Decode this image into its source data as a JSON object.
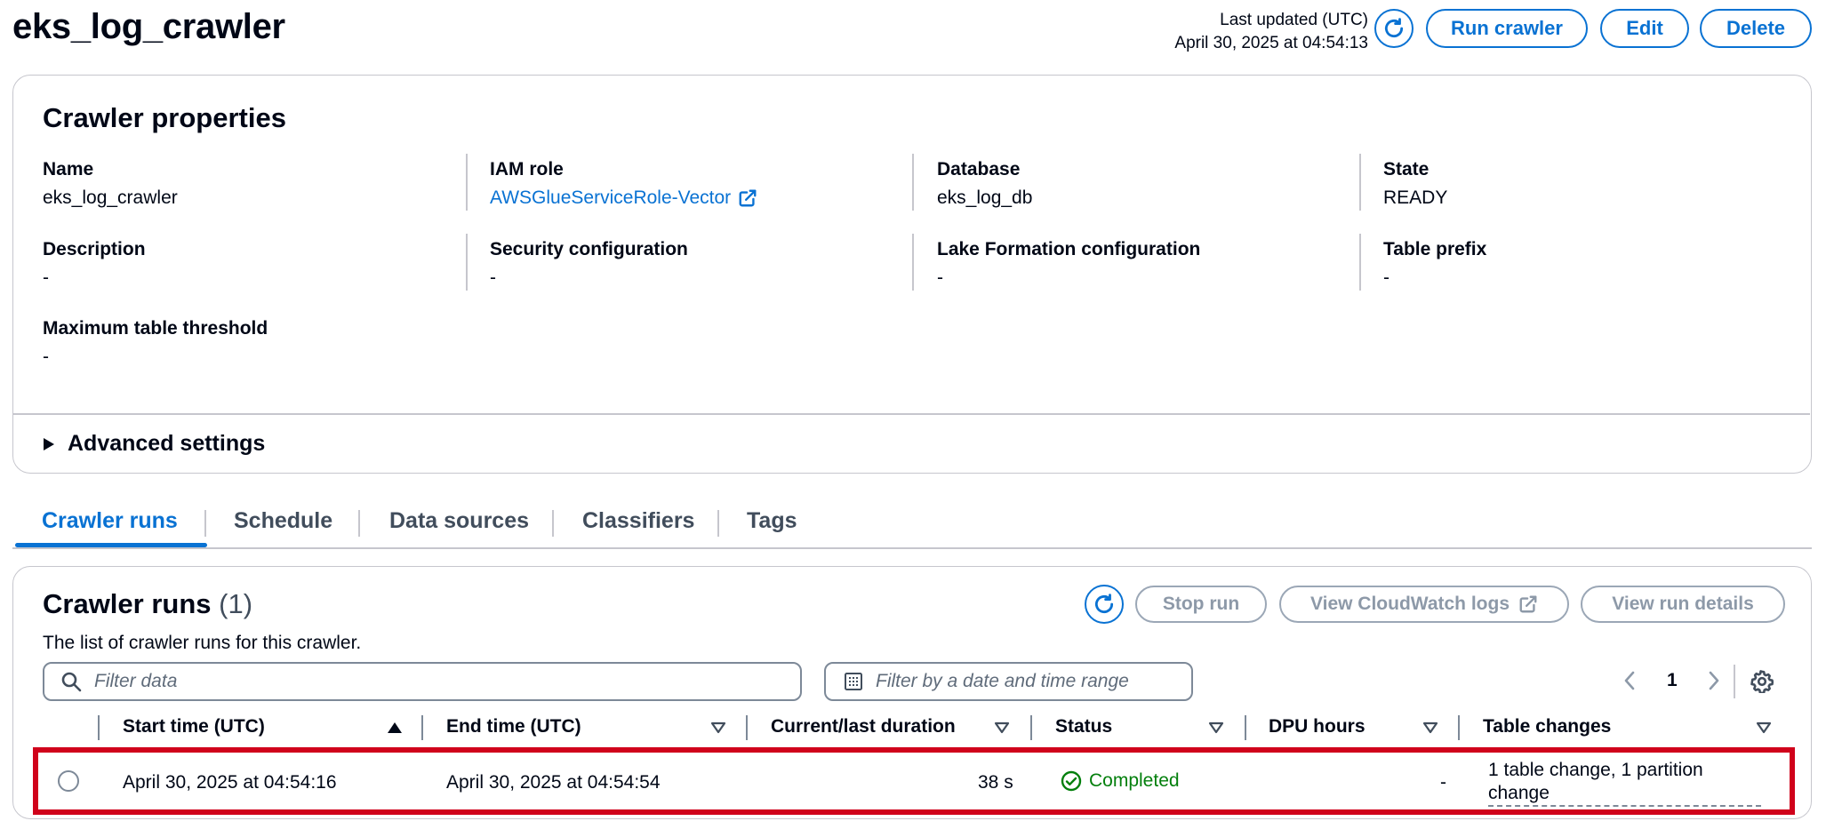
{
  "header": {
    "title": "eks_log_crawler",
    "last_updated_label": "Last updated (UTC)",
    "last_updated_value": "April 30, 2025 at 04:54:13",
    "run_crawler": "Run crawler",
    "edit": "Edit",
    "delete": "Delete"
  },
  "properties": {
    "title": "Crawler properties",
    "name_label": "Name",
    "name_value": "eks_log_crawler",
    "iam_label": "IAM role",
    "iam_value": "AWSGlueServiceRole-Vector",
    "database_label": "Database",
    "database_value": "eks_log_db",
    "state_label": "State",
    "state_value": "READY",
    "description_label": "Description",
    "description_value": "-",
    "security_label": "Security configuration",
    "security_value": "-",
    "lake_label": "Lake Formation configuration",
    "lake_value": "-",
    "prefix_label": "Table prefix",
    "prefix_value": "-",
    "threshold_label": "Maximum table threshold",
    "threshold_value": "-",
    "advanced": "Advanced settings"
  },
  "tabs": [
    "Crawler runs",
    "Schedule",
    "Data sources",
    "Classifiers",
    "Tags"
  ],
  "runs": {
    "title": "Crawler runs",
    "count": "(1)",
    "description": "The list of crawler runs for this crawler.",
    "stop_run": "Stop run",
    "view_logs": "View CloudWatch logs",
    "view_details": "View run details",
    "filter_placeholder": "Filter data",
    "date_placeholder": "Filter by a date and time range",
    "page": "1",
    "columns": [
      "Start time (UTC)",
      "End time (UTC)",
      "Current/last duration",
      "Status",
      "DPU hours",
      "Table changes"
    ],
    "rows": [
      {
        "start": "April 30, 2025 at 04:54:16",
        "end": "April 30, 2025 at 04:54:54",
        "duration": "38 s",
        "status": "Completed",
        "dpu": "-",
        "changes_line1": "1 table change, 1 partition",
        "changes_line2": "change"
      }
    ]
  },
  "colors": {
    "accent": "#0972d3",
    "success": "#037f0c",
    "highlight": "#d0021b"
  }
}
